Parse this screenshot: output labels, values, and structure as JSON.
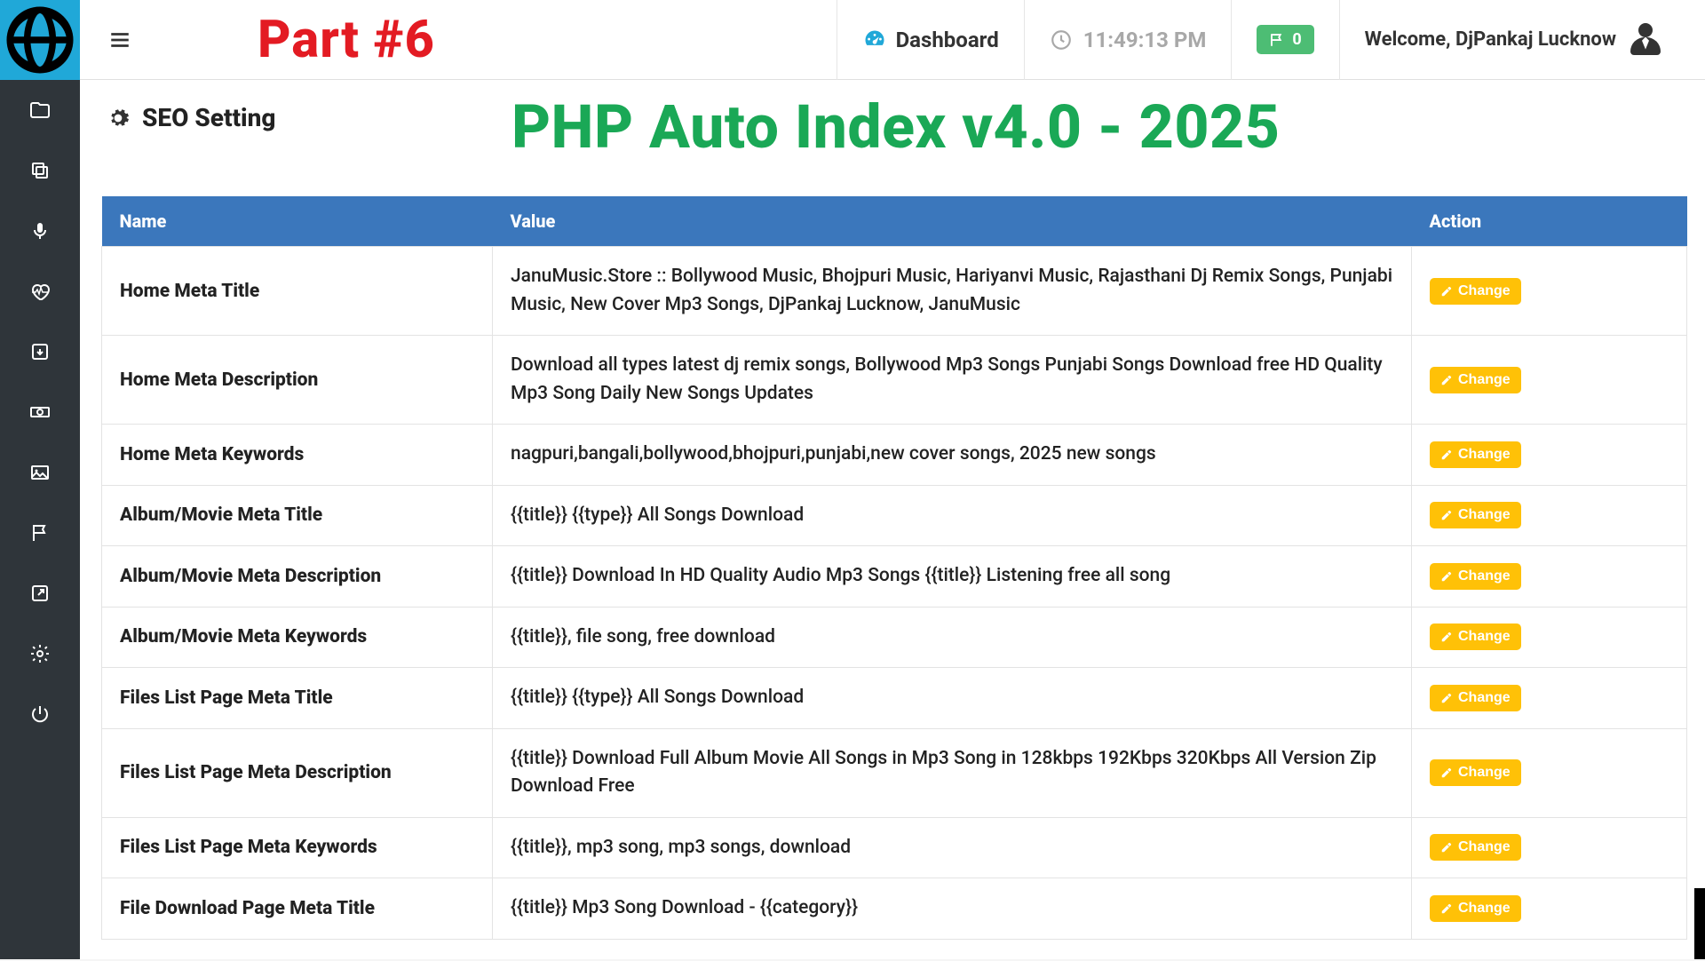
{
  "overlay": {
    "part": "Part #6",
    "title": "PHP Auto Index v4.0 - 2025"
  },
  "topbar": {
    "dashboard": "Dashboard",
    "time": "11:49:13 PM",
    "flag_count": "0",
    "welcome": "Welcome, DjPankaj Lucknow"
  },
  "page": {
    "title": "SEO Setting"
  },
  "table": {
    "headers": {
      "name": "Name",
      "value": "Value",
      "action": "Action"
    },
    "change_label": "Change",
    "rows": [
      {
        "name": "Home Meta Title",
        "value": "JanuMusic.Store :: Bollywood Music, Bhojpuri Music, Hariyanvi Music, Rajasthani Dj Remix Songs, Punjabi Music, New Cover Mp3 Songs, DjPankaj Lucknow, JanuMusic"
      },
      {
        "name": "Home Meta Description",
        "value": "Download all types latest dj remix songs, Bollywood Mp3 Songs Punjabi Songs Download free HD Quality Mp3 Song Daily New Songs Updates"
      },
      {
        "name": "Home Meta Keywords",
        "value": "nagpuri,bangali,bollywood,bhojpuri,punjabi,new cover songs, 2025 new songs"
      },
      {
        "name": "Album/Movie Meta Title",
        "value": "{{title}} {{type}} All Songs Download"
      },
      {
        "name": "Album/Movie Meta Description",
        "value": "{{title}} Download In HD Quality Audio Mp3 Songs {{title}} Listening free all song"
      },
      {
        "name": "Album/Movie Meta Keywords",
        "value": "{{title}}, file song, free download"
      },
      {
        "name": "Files List Page Meta Title",
        "value": "{{title}} {{type}} All Songs Download"
      },
      {
        "name": "Files List Page Meta Description",
        "value": "{{title}} Download Full Album Movie All Songs in Mp3 Song in 128kbps 192Kbps 320Kbps All Version Zip Download Free"
      },
      {
        "name": "Files List Page Meta Keywords",
        "value": "{{title}}, mp3 song, mp3 songs, download"
      },
      {
        "name": "File Download Page Meta Title",
        "value": "{{title}} Mp3 Song Download - {{category}}"
      }
    ]
  },
  "sidebar": {
    "icons": [
      "globe",
      "folder",
      "copy",
      "mic",
      "heart",
      "archive",
      "money",
      "image",
      "flag",
      "external",
      "gear",
      "power"
    ]
  }
}
